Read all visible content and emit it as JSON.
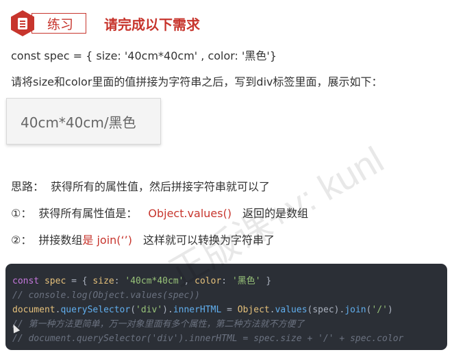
{
  "header": {
    "badge_label": "练习",
    "title": "请完成以下需求"
  },
  "spec_line": "const spec = { size: '40cm*40cm' , color: '黑色'}",
  "instruction": "请将size和color里面的值拼接为字符串之后，写到div标签里面，展示如下：",
  "demo_output": "40cm*40cm/黑色",
  "idea": {
    "label": "思路：",
    "text": "获得所有的属性值，然后拼接字符串就可以了"
  },
  "step1": {
    "num": "①：",
    "text": "获得所有属性值是：",
    "highlight": "Object.values()",
    "tail": "返回的是数组"
  },
  "step2": {
    "num": "②：",
    "text": "拼接数组",
    "highlight": "是 join(‘’)",
    "tail": "这样就可以转换为字符串了"
  },
  "code": {
    "l1": {
      "kw": "const",
      "name": "spec",
      "p1": " = { ",
      "k1": "size",
      "p2": ": ",
      "v1": "'40cm*40cm'",
      "p3": ", ",
      "k2": "color",
      "p4": ": ",
      "v2": "'黑色'",
      "p5": " }"
    },
    "l2": "// console.log(Object.values(spec))",
    "l3": {
      "obj": "document",
      "d1": ".",
      "m1": "querySelector",
      "a1": "(",
      "s1": "'div'",
      "a2": ").",
      "m2": "innerHTML",
      "eq": " = ",
      "obj2": "Object",
      "d2": ".",
      "m3": "values",
      "a3": "(spec).",
      "m4": "join",
      "a4": "(",
      "s2": "'/'",
      "a5": ")"
    },
    "l4": "// 第一种方法更简单，万一对象里面有多个属性，第二种方法就不方便了",
    "l5": "// document.querySelector('div').innerHTML = spec.size + '/' + spec.color"
  },
  "watermark": "正版课+v: kunl",
  "colors": {
    "accent": "#c7352d",
    "code_bg": "#2b2f36"
  }
}
